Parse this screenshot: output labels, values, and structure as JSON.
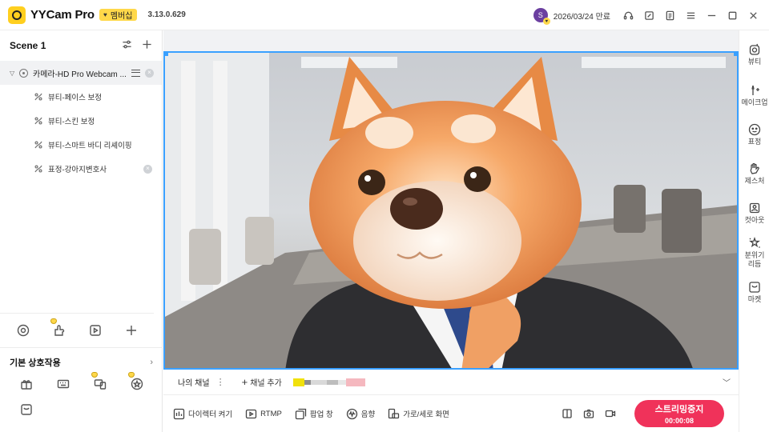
{
  "app": {
    "name": "YYCam Pro",
    "member_badge": "멤버십",
    "version": "3.13.0.629",
    "avatar_initial": "S",
    "expire_text": "2026/03/24 만료"
  },
  "colors": {
    "accent": "#3aa0ff",
    "brand_yellow": "#ffcf1f",
    "stream_button": "#f0325a",
    "selection_bg": "#f1f2f4"
  },
  "titlebar_icons": [
    "headset-icon",
    "note-edit-icon",
    "document-icon",
    "menu-icon",
    "minimize-icon",
    "maximize-icon",
    "close-icon"
  ],
  "scene": {
    "title": "Scene 1",
    "source": {
      "label": "카메라-HD Pro Webcam ..."
    },
    "filters": [
      {
        "label": "뷰티-페이스 보정",
        "has_remove": false
      },
      {
        "label": "뷰티-스킨 보정",
        "has_remove": false
      },
      {
        "label": "뷰티-스마트 바디 리셰이핑",
        "has_remove": false
      },
      {
        "label": "표정-강아지변호사",
        "has_remove": true
      }
    ]
  },
  "interactions": {
    "title": "기본 상호작용"
  },
  "channel_bar": {
    "my_channel": "나의 채널",
    "add_channel": "채널 추가"
  },
  "actions": {
    "director": "다이렉터 켜기",
    "rtmp": "RTMP",
    "popup": "팝업 창",
    "audio": "음향",
    "orientation": "가로/세로 화면"
  },
  "stream": {
    "label": "스트리밍중지",
    "timer": "00:00:08"
  },
  "rail": [
    {
      "label": "뷰티",
      "icon": "beauty-icon"
    },
    {
      "label": "메이크업",
      "icon": "makeup-icon"
    },
    {
      "label": "표정",
      "icon": "expression-icon"
    },
    {
      "label": "제스처",
      "icon": "gesture-icon"
    },
    {
      "label": "컷아웃",
      "icon": "cutout-icon"
    },
    {
      "label": "분위기리듬",
      "icon": "atmosphere-icon"
    },
    {
      "label": "마켓",
      "icon": "market-icon"
    }
  ]
}
